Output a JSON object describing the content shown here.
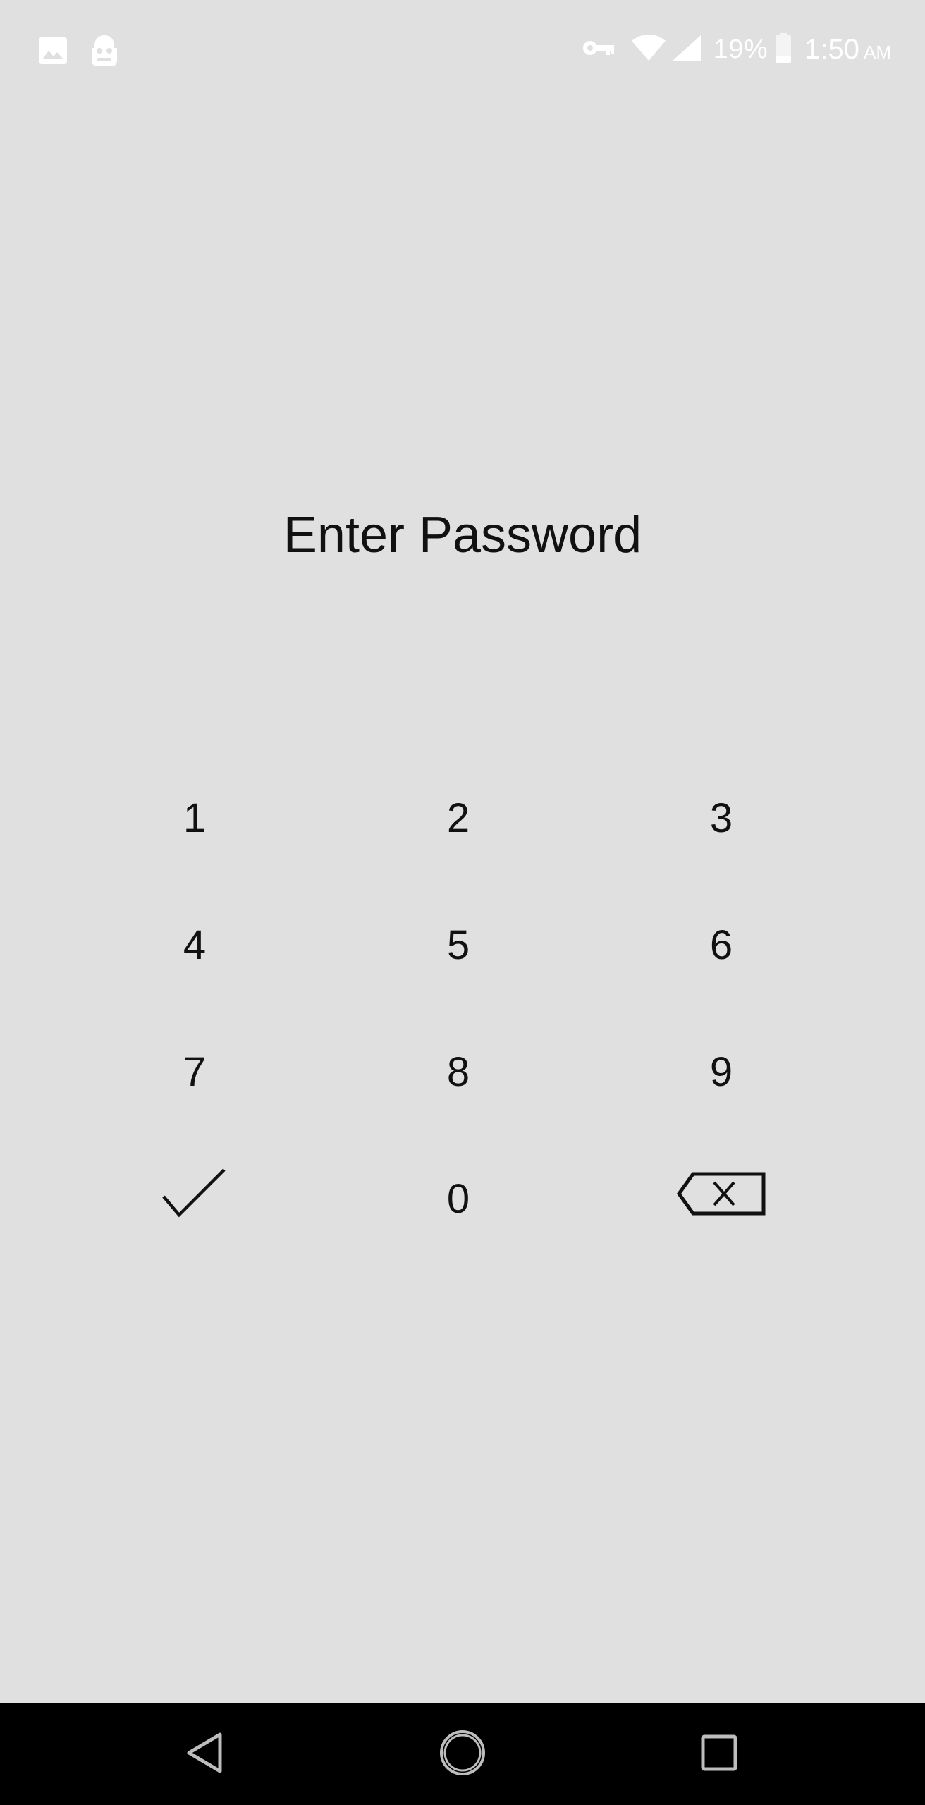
{
  "status_bar": {
    "left_icons": [
      "image-notification-icon",
      "vpn-robot-icon"
    ],
    "right_icons": [
      "vpn-key-icon",
      "wifi-icon",
      "cellular-signal-icon",
      "battery-icon"
    ],
    "battery_percent": "19%",
    "time": "1:50",
    "ampm": "AM",
    "icon_color": "#ffffff"
  },
  "title": "Enter Password",
  "keypad": {
    "keys": [
      "1",
      "2",
      "3",
      "4",
      "5",
      "6",
      "7",
      "8",
      "9",
      "0"
    ],
    "confirm_icon": "checkmark-icon",
    "delete_icon": "backspace-icon"
  },
  "nav_bar": {
    "background": "#000000",
    "buttons": [
      "back-icon",
      "home-icon",
      "recents-icon"
    ]
  },
  "colors": {
    "background": "#e0e0e0",
    "text": "#111111"
  }
}
